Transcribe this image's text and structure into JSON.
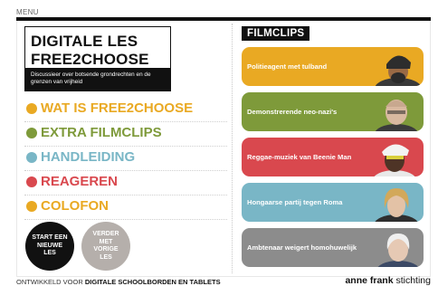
{
  "menu": {
    "label": "MENU"
  },
  "title": {
    "line1": "DIGITALE LES",
    "line2": "FREE2CHOOSE",
    "subtitle": "Discussieer over botsende grondrechten en de grenzen van vrijheid"
  },
  "nav": {
    "items": [
      {
        "label": "WAT IS FREE2CHOOSE",
        "color": "#e9a923"
      },
      {
        "label": "EXTRA FILMCLIPS",
        "color": "#7e9a3a"
      },
      {
        "label": "HANDLEIDING",
        "color": "#79b6c6"
      },
      {
        "label": "REAGEREN",
        "color": "#d9484e"
      },
      {
        "label": "COLOFON",
        "color": "#e9a923"
      }
    ]
  },
  "buttons": {
    "start": "START EEN NIEUWE LES",
    "continue": "VERDER MET VORIGE LES"
  },
  "filmclips": {
    "title": "FILMCLIPS",
    "clips": [
      {
        "label": "Politieagent met tulband",
        "color": "#e9a923"
      },
      {
        "label": "Demonstrerende neo-nazi's",
        "color": "#7e9a3a"
      },
      {
        "label": "Reggae-muziek van Beenie Man",
        "color": "#d9484e"
      },
      {
        "label": "Hongaarse partij tegen Roma",
        "color": "#79b6c6"
      },
      {
        "label": "Ambtenaar weigert homohuwelijk",
        "color": "#8c8c8c"
      }
    ]
  },
  "footer": {
    "prefix": "ONTWIKKELD VOOR",
    "emphasis": "DIGITALE SCHOOLBORDEN EN TABLETS",
    "brand_bold": "anne frank",
    "brand_light": "stichting"
  }
}
